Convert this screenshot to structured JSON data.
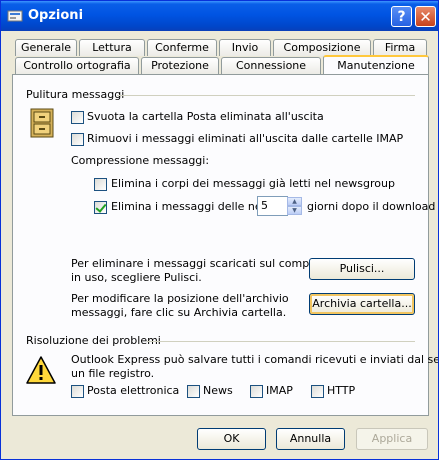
{
  "window": {
    "title": "Opzioni",
    "help_label": "?",
    "close_label": "✕"
  },
  "tabs_row1": [
    "Generale",
    "Lettura",
    "Conferme",
    "Invio",
    "Composizione",
    "Firma"
  ],
  "tabs_row2": [
    "Controllo ortografia",
    "Protezione",
    "Connessione",
    "Manutenzione"
  ],
  "active_tab": "Manutenzione",
  "cleanup": {
    "group_label": "Pulitura messaggi",
    "empty_deleted": {
      "label": "Svuota la cartella Posta eliminata all'uscita",
      "checked": false
    },
    "purge_imap": {
      "label": "Rimuovi i messaggi eliminati all'uscita dalle cartelle IMAP",
      "checked": false
    },
    "compression_label": "Compressione messaggi:",
    "delete_bodies": {
      "label": "Elimina i corpi dei messaggi già letti nel newsgroup",
      "checked": false
    },
    "delete_news": {
      "label": "Elimina i messaggi delle news",
      "checked": true
    },
    "days_value": "5",
    "days_suffix": "giorni dopo il download",
    "cleanup_text_1": "Per eliminare i messaggi scaricati sul computer",
    "cleanup_text_2": "in uso, scegliere Pulisci.",
    "cleanup_button": "Pulisci...",
    "store_text_1": "Per modificare la posizione dell'archivio",
    "store_text_2": "messaggi, fare clic su Archivia cartella.",
    "store_button": "Archivia cartella..."
  },
  "troubleshoot": {
    "group_label": "Risoluzione dei problemi",
    "text_1": "Outlook Express può salvare tutti i comandi ricevuti e inviati dal server in",
    "text_2": "un file registro.",
    "options": [
      {
        "label": "Posta elettronica",
        "checked": false
      },
      {
        "label": "News",
        "checked": false
      },
      {
        "label": "IMAP",
        "checked": false
      },
      {
        "label": "HTTP",
        "checked": false
      }
    ]
  },
  "footer": {
    "ok": "OK",
    "cancel": "Annulla",
    "apply": "Applica"
  },
  "colors": {
    "titlebar": "#0054e3",
    "face": "#ece9d8",
    "panel": "#fcfcfe",
    "accent": "#ffc83c"
  }
}
